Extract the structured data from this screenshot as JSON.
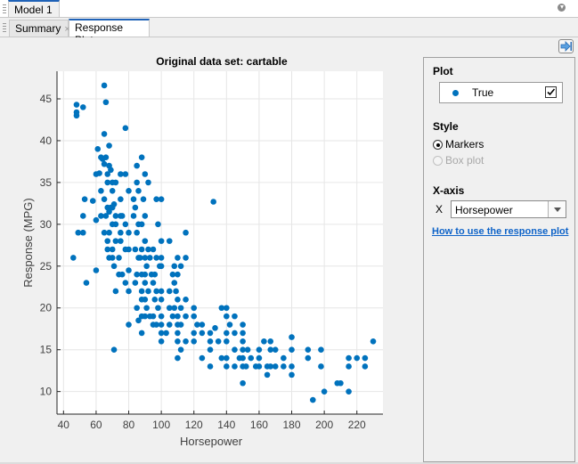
{
  "window": {
    "document_tab": "Model 1",
    "sub_tabs": [
      {
        "label": "Summary",
        "active": false
      },
      {
        "label": "Response Plot",
        "active": true
      }
    ],
    "close_glyph": "×"
  },
  "panel": {
    "plot_header": "Plot",
    "legend_entry": {
      "label": "True",
      "checked": true,
      "color": "#0072bd"
    },
    "style_header": "Style",
    "style_options": [
      {
        "label": "Markers",
        "selected": true,
        "enabled": true
      },
      {
        "label": "Box plot",
        "selected": false,
        "enabled": false
      }
    ],
    "xaxis_header": "X-axis",
    "xaxis_prefix": "X",
    "xaxis_selected": "Horsepower",
    "help_link": "How to use the response plot"
  },
  "icons": {
    "dock": "dock-arrow-icon",
    "settings": "settings-icon"
  },
  "chart_data": {
    "type": "scatter",
    "title": "Original data set: cartable",
    "xlabel": "Horsepower",
    "ylabel": "Response (MPG)",
    "xlim": [
      36,
      236
    ],
    "ylim": [
      7.3,
      48.3
    ],
    "xticks": [
      40,
      60,
      80,
      100,
      120,
      140,
      160,
      180,
      200,
      220
    ],
    "yticks": [
      10,
      15,
      20,
      25,
      30,
      35,
      40,
      45
    ],
    "grid": true,
    "marker_color": "#0072bd",
    "series": [
      {
        "name": "True",
        "points": [
          [
            46,
            26
          ],
          [
            48,
            43.4
          ],
          [
            48,
            44.3
          ],
          [
            48,
            43
          ],
          [
            49,
            29
          ],
          [
            52,
            44
          ],
          [
            52,
            29
          ],
          [
            52,
            31
          ],
          [
            53,
            33
          ],
          [
            54,
            23
          ],
          [
            58,
            32.8
          ],
          [
            60,
            24.5
          ],
          [
            60,
            30.5
          ],
          [
            60,
            36
          ],
          [
            61,
            39
          ],
          [
            62,
            36.1
          ],
          [
            63,
            38
          ],
          [
            63,
            31
          ],
          [
            63,
            34
          ],
          [
            64,
            37.8
          ],
          [
            65,
            46.6
          ],
          [
            65,
            40.8
          ],
          [
            65,
            29
          ],
          [
            65,
            33
          ],
          [
            65,
            37.2
          ],
          [
            66,
            44.6
          ],
          [
            66,
            38
          ],
          [
            66,
            31
          ],
          [
            67,
            36
          ],
          [
            67,
            32
          ],
          [
            67,
            35
          ],
          [
            67,
            28
          ],
          [
            67,
            27
          ],
          [
            68,
            39.4
          ],
          [
            68,
            37
          ],
          [
            68,
            31.5
          ],
          [
            68,
            29
          ],
          [
            68,
            26
          ],
          [
            69,
            32
          ],
          [
            69,
            36.5
          ],
          [
            70,
            32
          ],
          [
            70,
            35
          ],
          [
            70,
            34
          ],
          [
            70,
            30
          ],
          [
            70,
            27
          ],
          [
            70,
            26
          ],
          [
            71,
            32.4
          ],
          [
            71,
            15
          ],
          [
            71,
            25
          ],
          [
            72,
            35
          ],
          [
            72,
            28
          ],
          [
            72,
            30
          ],
          [
            72,
            22
          ],
          [
            72,
            31
          ],
          [
            74,
            24
          ],
          [
            74,
            26
          ],
          [
            75,
            33
          ],
          [
            75,
            36
          ],
          [
            75,
            31
          ],
          [
            75,
            29
          ],
          [
            75,
            28
          ],
          [
            76,
            31
          ],
          [
            76,
            24
          ],
          [
            78,
            41.5
          ],
          [
            78,
            36
          ],
          [
            78,
            30
          ],
          [
            78,
            27
          ],
          [
            78,
            23
          ],
          [
            80,
            34
          ],
          [
            80,
            29
          ],
          [
            80,
            27
          ],
          [
            80,
            24.5
          ],
          [
            80,
            18
          ],
          [
            80,
            22
          ],
          [
            83,
            31
          ],
          [
            83,
            33
          ],
          [
            84,
            32
          ],
          [
            84,
            27
          ],
          [
            84,
            23
          ],
          [
            85,
            37
          ],
          [
            85,
            35
          ],
          [
            85,
            29
          ],
          [
            85,
            24
          ],
          [
            85,
            20
          ],
          [
            86,
            26
          ],
          [
            86,
            18.5
          ],
          [
            86,
            34
          ],
          [
            86,
            30
          ],
          [
            87,
            26
          ],
          [
            88,
            38
          ],
          [
            88,
            30
          ],
          [
            88,
            27
          ],
          [
            88,
            24
          ],
          [
            88,
            21
          ],
          [
            88,
            19
          ],
          [
            88,
            17
          ],
          [
            88,
            22
          ],
          [
            89,
            33
          ],
          [
            90,
            36
          ],
          [
            90,
            31
          ],
          [
            90,
            28
          ],
          [
            90,
            26
          ],
          [
            90,
            24
          ],
          [
            90,
            21
          ],
          [
            90,
            19
          ],
          [
            90,
            23
          ],
          [
            91,
            25
          ],
          [
            91,
            20
          ],
          [
            92,
            35
          ],
          [
            92,
            27
          ],
          [
            92,
            22
          ],
          [
            93,
            19
          ],
          [
            93,
            26
          ],
          [
            94,
            24
          ],
          [
            95,
            27
          ],
          [
            95,
            23
          ],
          [
            95,
            19
          ],
          [
            95,
            18
          ],
          [
            96,
            24
          ],
          [
            96,
            21
          ],
          [
            97,
            26
          ],
          [
            97,
            22
          ],
          [
            97,
            18
          ],
          [
            97,
            33
          ],
          [
            98,
            30
          ],
          [
            98,
            20
          ],
          [
            99,
            25
          ],
          [
            100,
            33
          ],
          [
            100,
            28
          ],
          [
            100,
            26
          ],
          [
            100,
            25
          ],
          [
            100,
            21
          ],
          [
            100,
            19
          ],
          [
            100,
            18
          ],
          [
            100,
            17
          ],
          [
            100,
            16
          ],
          [
            100,
            22
          ],
          [
            103,
            17
          ],
          [
            105,
            28
          ],
          [
            105,
            22
          ],
          [
            105,
            20
          ],
          [
            105,
            18
          ],
          [
            107,
            24
          ],
          [
            107,
            19
          ],
          [
            108,
            25
          ],
          [
            108,
            23
          ],
          [
            108,
            20
          ],
          [
            109,
            22
          ],
          [
            110,
            26
          ],
          [
            110,
            24
          ],
          [
            110,
            21
          ],
          [
            110,
            19
          ],
          [
            110,
            18
          ],
          [
            110,
            17
          ],
          [
            110,
            16
          ],
          [
            110,
            14
          ],
          [
            112,
            25
          ],
          [
            112,
            20
          ],
          [
            112,
            18
          ],
          [
            112,
            15
          ],
          [
            115,
            29
          ],
          [
            115,
            26
          ],
          [
            115,
            21
          ],
          [
            115,
            19
          ],
          [
            115,
            16
          ],
          [
            120,
            19
          ],
          [
            120,
            17
          ],
          [
            120,
            20
          ],
          [
            120,
            16
          ],
          [
            122,
            18
          ],
          [
            125,
            18
          ],
          [
            125,
            14
          ],
          [
            125,
            17
          ],
          [
            130,
            16
          ],
          [
            130,
            17
          ],
          [
            130,
            13
          ],
          [
            130,
            15
          ],
          [
            132,
            32.7
          ],
          [
            133,
            17.6
          ],
          [
            135,
            16
          ],
          [
            137,
            20
          ],
          [
            137,
            14
          ],
          [
            140,
            20
          ],
          [
            140,
            19
          ],
          [
            140,
            17
          ],
          [
            140,
            14
          ],
          [
            140,
            16
          ],
          [
            140,
            13
          ],
          [
            142,
            18
          ],
          [
            145,
            19
          ],
          [
            145,
            17
          ],
          [
            145,
            15
          ],
          [
            145,
            13
          ],
          [
            148,
            14
          ],
          [
            150,
            18
          ],
          [
            150,
            17
          ],
          [
            150,
            16
          ],
          [
            150,
            15
          ],
          [
            150,
            14
          ],
          [
            150,
            13
          ],
          [
            150,
            11
          ],
          [
            152,
            13
          ],
          [
            153,
            15
          ],
          [
            155,
            14
          ],
          [
            158,
            13
          ],
          [
            160,
            15
          ],
          [
            160,
            14
          ],
          [
            160,
            13
          ],
          [
            163,
            16
          ],
          [
            165,
            13
          ],
          [
            165,
            12
          ],
          [
            167,
            16
          ],
          [
            167,
            15
          ],
          [
            167,
            13
          ],
          [
            170,
            13
          ],
          [
            170,
            15
          ],
          [
            175,
            13
          ],
          [
            175,
            14
          ],
          [
            180,
            16.5
          ],
          [
            180,
            15
          ],
          [
            180,
            12
          ],
          [
            180,
            13
          ],
          [
            190,
            15
          ],
          [
            190,
            14
          ],
          [
            193,
            9
          ],
          [
            198,
            15
          ],
          [
            198,
            13
          ],
          [
            200,
            10
          ],
          [
            208,
            11
          ],
          [
            210,
            11
          ],
          [
            215,
            14
          ],
          [
            215,
            13
          ],
          [
            215,
            10
          ],
          [
            220,
            14
          ],
          [
            225,
            14
          ],
          [
            225,
            13
          ],
          [
            230,
            16
          ]
        ]
      }
    ]
  }
}
